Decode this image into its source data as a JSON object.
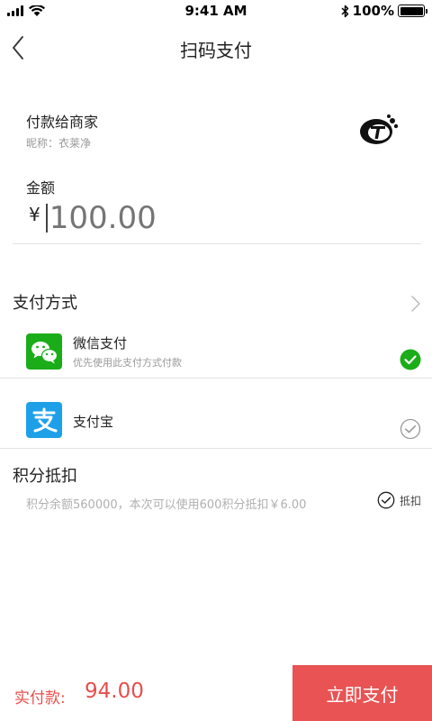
{
  "status_bar": {
    "time": "9:41 AM",
    "battery": "100%",
    "battery_level": 1.0
  },
  "nav": {
    "title": "扫码支付"
  },
  "merchant": {
    "label": "付款给商家",
    "nickname": "昵称：衣莱净"
  },
  "amount": {
    "label": "金额",
    "currency": "¥",
    "placeholder": "100.00"
  },
  "payment_method": {
    "title": "支付方式",
    "options": [
      {
        "name": "微信支付",
        "subtitle": "优先使用此支付方式付款",
        "selected": true,
        "icon": "wechat-icon"
      },
      {
        "name": "支付宝",
        "subtitle": "",
        "selected": false,
        "icon": "alipay-icon"
      }
    ]
  },
  "points": {
    "title": "积分抵扣",
    "description": "积分余额560000，本次可以使用600积分抵扣￥6.00",
    "toggle_label": "抵扣",
    "checked": false
  },
  "footer": {
    "paid_label": "实付款:",
    "paid_value": "94.00",
    "pay_button": "立即支付"
  },
  "colors": {
    "accent": "#e95353",
    "price_text": "#e84e4b",
    "wechat_green": "#1aad19",
    "alipay_blue": "#1ea0e9"
  }
}
